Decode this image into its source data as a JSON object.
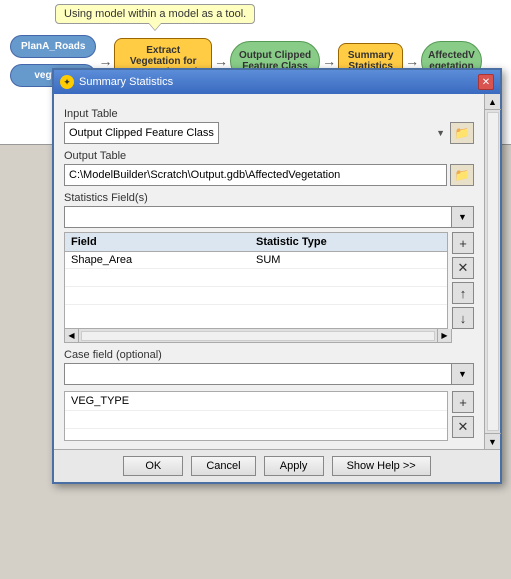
{
  "tooltip": {
    "text": "Using model within a model as a tool."
  },
  "flowchart": {
    "nodes": [
      {
        "id": "planA",
        "label": "PlanA_Roads",
        "type": "oval-blue"
      },
      {
        "id": "vegtype",
        "label": "vegtype",
        "type": "oval-blue"
      },
      {
        "id": "extract",
        "label": "Extract\nVegetation for\nProposed Roads",
        "type": "rect-yellow"
      },
      {
        "id": "output_clipped",
        "label": "Output Clipped\nFeature Class",
        "type": "oval-green"
      },
      {
        "id": "summary",
        "label": "Summary\nStatistics",
        "type": "rect-yellow"
      },
      {
        "id": "affected_veg",
        "label": "AffectedV\negetation",
        "type": "oval-green"
      }
    ]
  },
  "dialog": {
    "title": "Summary Statistics",
    "input_table_label": "Input Table",
    "input_table_value": "Output Clipped Feature Class",
    "output_table_label": "Output Table",
    "output_table_value": "C:\\ModelBuilder\\Scratch\\Output.gdb\\AffectedVegetation",
    "statistics_fields_label": "Statistics Field(s)",
    "table_headers": {
      "field": "Field",
      "statistic_type": "Statistic Type"
    },
    "table_rows": [
      {
        "field": "Shape_Area",
        "statistic": "SUM"
      }
    ],
    "case_field_label": "Case field (optional)",
    "veg_rows": [
      {
        "value": "VEG_TYPE"
      }
    ],
    "footer_buttons": {
      "ok": "OK",
      "cancel": "Cancel",
      "apply": "Apply",
      "show_help": "Show Help >>"
    }
  }
}
